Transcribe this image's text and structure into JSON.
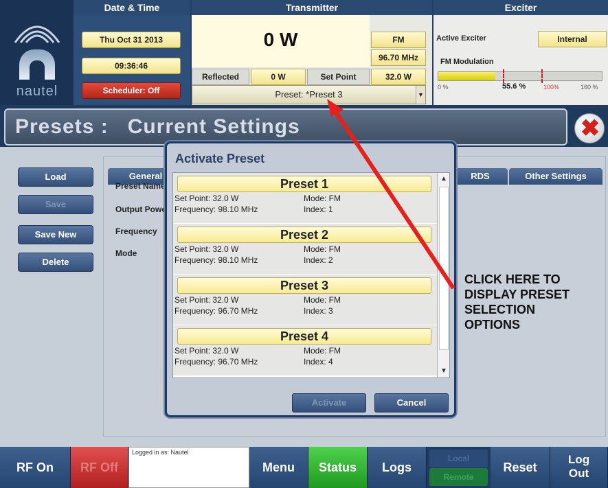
{
  "header": {
    "logo_text": "nautel",
    "date_time": {
      "heading": "Date & Time",
      "date": "Thu Oct 31 2013",
      "time": "09:36:46",
      "scheduler": "Scheduler: Off"
    },
    "transmitter": {
      "heading": "Transmitter",
      "power": "0 W",
      "mode": "FM",
      "frequency": "96.70 MHz",
      "reflected_label": "Reflected",
      "reflected_value": "0 W",
      "set_point_label": "Set Point",
      "set_point_value": "32.0 W",
      "preset": "Preset: *Preset 3"
    },
    "exciter": {
      "heading": "Exciter",
      "active_exciter_label": "Active Exciter",
      "active_exciter_value": "Internal",
      "fm_modulation_label": "FM Modulation",
      "modulation_percent": 55.6,
      "modulation_value": "55.6 %",
      "scale_min": "0 %",
      "scale_mid": "100%",
      "scale_max": "160 %"
    }
  },
  "page": {
    "title": "Presets :   Current Settings"
  },
  "left_buttons": {
    "load": "Load",
    "save": "Save",
    "save_new": "Save New",
    "delete": "Delete"
  },
  "tabs": {
    "general": "General",
    "rds": "RDS",
    "other": "Other Settings"
  },
  "fields": {
    "preset_name": "Preset Name",
    "output_power": "Output Power",
    "frequency": "Frequency",
    "mode": "Mode"
  },
  "modal": {
    "title": "Activate Preset",
    "presets": [
      {
        "name": "Preset 1",
        "set_point": "Set Point: 32.0 W",
        "frequency": "Frequency: 98.10 MHz",
        "mode": "Mode: FM",
        "index": "Index: 1"
      },
      {
        "name": "Preset 2",
        "set_point": "Set Point: 32.0 W",
        "frequency": "Frequency: 98.10 MHz",
        "mode": "Mode: FM",
        "index": "Index: 2"
      },
      {
        "name": "Preset 3",
        "set_point": "Set Point: 32.0 W",
        "frequency": "Frequency: 96.70 MHz",
        "mode": "Mode: FM",
        "index": "Index: 3"
      },
      {
        "name": "Preset 4",
        "set_point": "Set Point: 32.0 W",
        "frequency": "Frequency: 96.70 MHz",
        "mode": "Mode: FM",
        "index": "Index: 4"
      }
    ],
    "activate_label": "Activate",
    "cancel_label": "Cancel"
  },
  "annotation": {
    "text_lines": [
      "CLICK HERE TO",
      "DISPLAY PRESET",
      "SELECTION",
      "OPTIONS"
    ],
    "color": "#e8201c"
  },
  "bottom": {
    "rf_on": "RF On",
    "rf_off": "RF Off",
    "logged_in": "Logged in as: Nautel",
    "menu": "Menu",
    "status": "Status",
    "logs": "Logs",
    "local": "Local",
    "remote": "Remote",
    "reset": "Reset",
    "logout_line1": "Log",
    "logout_line2": "Out"
  },
  "icons": {
    "close": "close-icon",
    "dropdown": "chevron-down-icon",
    "scroll_up": "arrow-up-icon",
    "scroll_down": "arrow-down-icon"
  }
}
